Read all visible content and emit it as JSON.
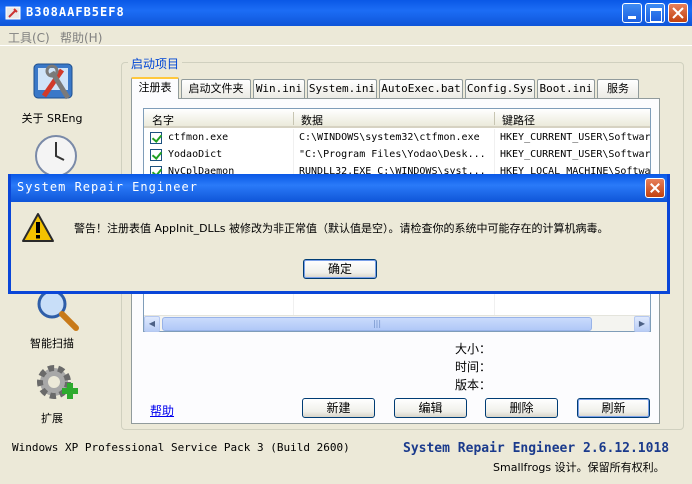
{
  "window": {
    "title": "B308AAFB5EF8"
  },
  "menu": {
    "items": [
      "工具(C)",
      "帮助(H)"
    ]
  },
  "nav": {
    "items": [
      {
        "label": "关于 SREng",
        "icon": "tools-icon"
      },
      {
        "label": "",
        "icon": "clock-icon"
      },
      {
        "label": "智能扫描",
        "icon": "magnifier-icon"
      },
      {
        "label": "扩展",
        "icon": "gear-plus-icon"
      }
    ]
  },
  "group": {
    "title": "启动项目"
  },
  "tabs": [
    "注册表",
    "启动文件夹",
    "Win.ini",
    "System.ini",
    "AutoExec.bat",
    "Config.Sys",
    "Boot.ini",
    "服务"
  ],
  "list": {
    "columns": [
      "名字",
      "数据",
      "键路径"
    ],
    "rows": [
      {
        "name": "ctfmon.exe",
        "data": "C:\\WINDOWS\\system32\\ctfmon.exe",
        "path": "HKEY_CURRENT_USER\\Softwar"
      },
      {
        "name": "YodaoDict",
        "data": "\"C:\\Program Files\\Yodao\\Desk...",
        "path": "HKEY_CURRENT_USER\\Softwar"
      },
      {
        "name": "NvCplDaemon",
        "data": "RUNDLL32.EXE C:\\WINDOWS\\syst...",
        "path": "HKEY_LOCAL_MACHINE\\Softwa"
      }
    ]
  },
  "details": {
    "size_label": "大小：",
    "time_label": "时间：",
    "version_label": "版本："
  },
  "actions": {
    "help": "帮助",
    "new": "新建",
    "edit": "编辑",
    "delete": "删除",
    "refresh": "刷新"
  },
  "status": {
    "os": "Windows XP Professional Service Pack 3 (Build 2600)",
    "brand": "System Repair Engineer 2.6.12.1018",
    "copyright": "Smallfrogs 设计。保留所有权利。"
  },
  "dialog": {
    "title": "System Repair Engineer",
    "message": "警告！注册表值 AppInit_DLLs 被修改为非正常值（默认值是空）。请检查你的系统中可能存在的计算机病毒。",
    "ok": "确定"
  },
  "colors": {
    "titlebar": "#0a58e6",
    "accent": "#0046d5",
    "checkbox": "#21a121",
    "warning": "#f3c200"
  }
}
